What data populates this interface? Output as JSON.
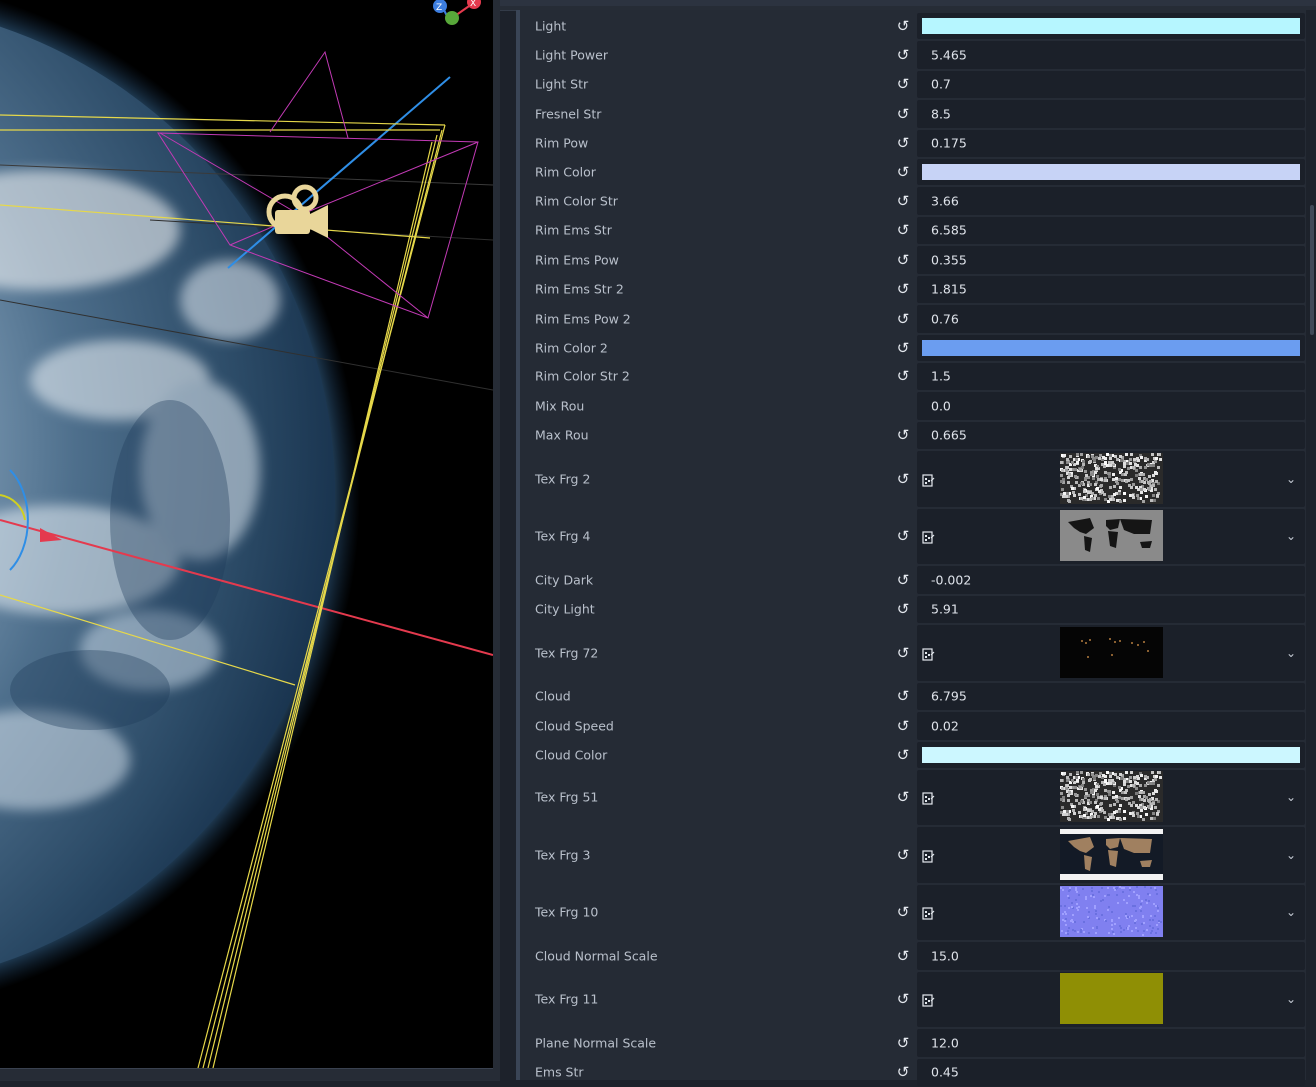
{
  "viewport": {
    "gizmo": {
      "x_label": "X",
      "z_label": "Z"
    }
  },
  "inspector": {
    "properties": [
      {
        "label": "Light",
        "kind": "color",
        "color": "#b6f6ff",
        "revert": true
      },
      {
        "label": "Light Power",
        "kind": "number",
        "value": "5.465",
        "revert": true
      },
      {
        "label": "Light Str",
        "kind": "number",
        "value": "0.7",
        "revert": true
      },
      {
        "label": "Fresnel Str",
        "kind": "number",
        "value": "8.5",
        "revert": true
      },
      {
        "label": "Rim Pow",
        "kind": "number",
        "value": "0.175",
        "revert": true
      },
      {
        "label": "Rim Color",
        "kind": "color",
        "color": "#c7d3f6",
        "revert": true
      },
      {
        "label": "Rim Color Str",
        "kind": "number",
        "value": "3.66",
        "revert": true
      },
      {
        "label": "Rim Ems Str",
        "kind": "number",
        "value": "6.585",
        "revert": true
      },
      {
        "label": "Rim Ems Pow",
        "kind": "number",
        "value": "0.355",
        "revert": true
      },
      {
        "label": "Rim Ems Str 2",
        "kind": "number",
        "value": "1.815",
        "revert": true
      },
      {
        "label": "Rim Ems Pow 2",
        "kind": "number",
        "value": "0.76",
        "revert": true
      },
      {
        "label": "Rim Color 2",
        "kind": "color",
        "color": "#6b9df0",
        "revert": true
      },
      {
        "label": "Rim Color Str 2",
        "kind": "number",
        "value": "1.5",
        "revert": true
      },
      {
        "label": "Mix Rou",
        "kind": "number",
        "value": "0.0",
        "revert": false
      },
      {
        "label": "Max Rou",
        "kind": "number",
        "value": "0.665",
        "revert": true
      },
      {
        "label": "Tex Frg 2",
        "kind": "texture",
        "preview": "noise-gray",
        "revert": true
      },
      {
        "label": "Tex Frg 4",
        "kind": "texture",
        "preview": "world-gray",
        "revert": true
      },
      {
        "label": "City Dark",
        "kind": "number",
        "value": "-0.002",
        "revert": true
      },
      {
        "label": "City Light",
        "kind": "number",
        "value": "5.91",
        "revert": true
      },
      {
        "label": "Tex Frg 72",
        "kind": "texture",
        "preview": "city-lights",
        "revert": true
      },
      {
        "label": "Cloud",
        "kind": "number",
        "value": "6.795",
        "revert": true
      },
      {
        "label": "Cloud Speed",
        "kind": "number",
        "value": "0.02",
        "revert": true
      },
      {
        "label": "Cloud Color",
        "kind": "color",
        "color": "#ccf7ff",
        "revert": true
      },
      {
        "label": "Tex Frg 51",
        "kind": "texture",
        "preview": "noise-gray",
        "revert": true
      },
      {
        "label": "Tex Frg 3",
        "kind": "texture",
        "preview": "world-color",
        "revert": true
      },
      {
        "label": "Tex Frg 10",
        "kind": "texture",
        "preview": "normal-map",
        "revert": true
      },
      {
        "label": "Cloud Normal Scale",
        "kind": "number",
        "value": "15.0",
        "revert": true
      },
      {
        "label": "Tex Frg 11",
        "kind": "texture",
        "preview": "olive",
        "revert": true
      },
      {
        "label": "Plane Normal Scale",
        "kind": "number",
        "value": "12.0",
        "revert": true
      },
      {
        "label": "Ems Str",
        "kind": "number",
        "value": "0.45",
        "revert": true
      }
    ]
  }
}
